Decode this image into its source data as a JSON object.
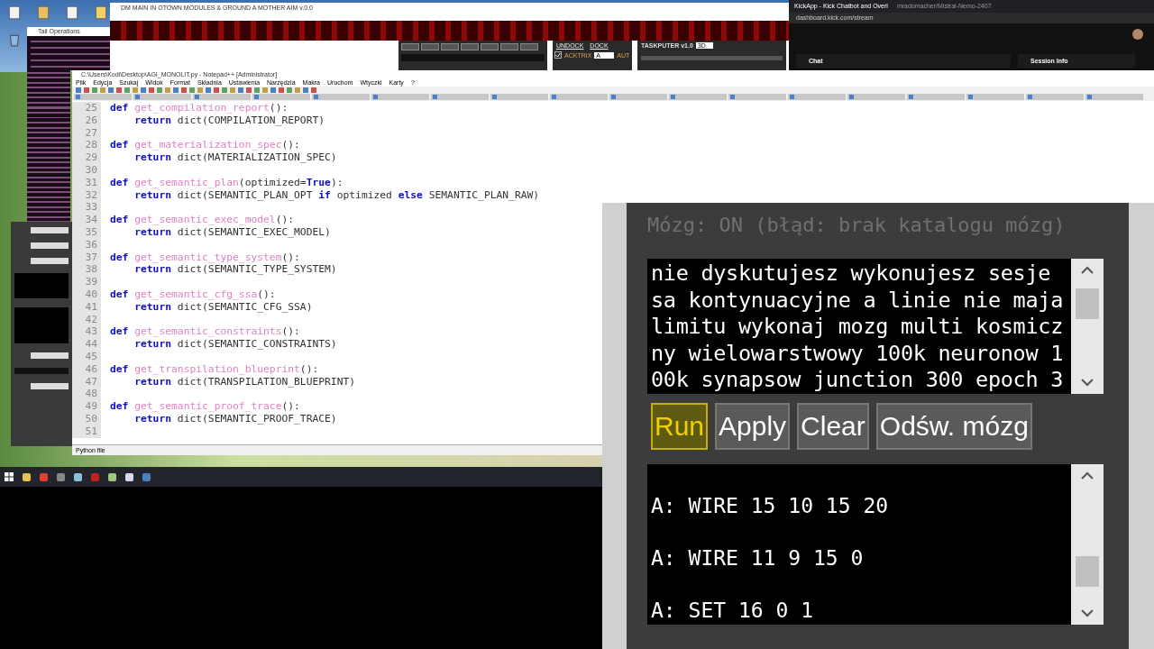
{
  "log_window": {
    "title": "Tail Operations"
  },
  "app_window": {
    "title": "DM MAIN IN OTOWN MODULES & GROUND A MOTHER AIM v.0.0",
    "dock2": {
      "buttons": [
        "UNDOCK",
        "DOCK"
      ],
      "checkbox": {
        "label": "ACKTRIX",
        "checked": true
      },
      "select": "A",
      "trailing": "AUT"
    },
    "taskputer": {
      "title": "TASKPUTER v1.0",
      "mode": "3D"
    }
  },
  "browser": {
    "tabs": [
      {
        "title": "KickApp - Kick Chatbot and Overl",
        "selected": true
      },
      {
        "title": "mradomacher/Mistral-Nemo-2407",
        "selected": false
      }
    ],
    "url": "dashboard.kick.com/stream",
    "panels": [
      "Chat",
      "Session Info"
    ]
  },
  "editor": {
    "title": "C:\\Users\\Kodi\\Desktop\\AGI_MONOLIT.py - Notepad++ [Administrator]",
    "menu": [
      "Plik",
      "Edycja",
      "Szukaj",
      "Widok",
      "Format",
      "Składnia",
      "Ustawienia",
      "Narzędzia",
      "Makra",
      "Uruchom",
      "Wtyczki",
      "Karty",
      "?"
    ],
    "lines": [
      {
        "number": "25",
        "tokens": [
          {
            "text": "def ",
            "kind": "kw"
          },
          {
            "text": "get_compilation_report",
            "kind": "fn"
          },
          {
            "text": "():",
            "kind": "plain"
          }
        ]
      },
      {
        "number": "26",
        "tokens": [
          {
            "text": "    return ",
            "kind": "kw"
          },
          {
            "text": "dict(COMPILATION_REPORT)",
            "kind": "plain"
          }
        ]
      },
      {
        "number": "27"
      },
      {
        "number": "28",
        "tokens": [
          {
            "text": "def ",
            "kind": "kw"
          },
          {
            "text": "get_materialization_spec",
            "kind": "fn"
          },
          {
            "text": "():",
            "kind": "plain"
          }
        ]
      },
      {
        "number": "29",
        "tokens": [
          {
            "text": "    return ",
            "kind": "kw"
          },
          {
            "text": "dict(MATERIALIZATION_SPEC)",
            "kind": "plain"
          }
        ]
      },
      {
        "number": "30"
      },
      {
        "number": "31",
        "tokens": [
          {
            "text": "def ",
            "kind": "kw"
          },
          {
            "text": "get_semantic_plan",
            "kind": "fn"
          },
          {
            "text": "(optimized=",
            "kind": "plain"
          },
          {
            "text": "True",
            "kind": "kw"
          },
          {
            "text": "):",
            "kind": "plain"
          }
        ]
      },
      {
        "number": "32",
        "tokens": [
          {
            "text": "    return ",
            "kind": "kw"
          },
          {
            "text": "dict(SEMANTIC_PLAN_OPT ",
            "kind": "plain"
          },
          {
            "text": "if ",
            "kind": "kw"
          },
          {
            "text": "optimized ",
            "kind": "plain"
          },
          {
            "text": "else ",
            "kind": "kw"
          },
          {
            "text": "SEMANTIC_PLAN_RAW)",
            "kind": "plain"
          }
        ]
      },
      {
        "number": "33"
      },
      {
        "number": "34",
        "tokens": [
          {
            "text": "def ",
            "kind": "kw"
          },
          {
            "text": "get_semantic_exec_model",
            "kind": "fn"
          },
          {
            "text": "():",
            "kind": "plain"
          }
        ]
      },
      {
        "number": "35",
        "tokens": [
          {
            "text": "    return ",
            "kind": "kw"
          },
          {
            "text": "dict(SEMANTIC_EXEC_MODEL)",
            "kind": "plain"
          }
        ]
      },
      {
        "number": "36"
      },
      {
        "number": "37",
        "tokens": [
          {
            "text": "def ",
            "kind": "kw"
          },
          {
            "text": "get_semantic_type_system",
            "kind": "fn"
          },
          {
            "text": "():",
            "kind": "plain"
          }
        ]
      },
      {
        "number": "38",
        "tokens": [
          {
            "text": "    return ",
            "kind": "kw"
          },
          {
            "text": "dict(SEMANTIC_TYPE_SYSTEM)",
            "kind": "plain"
          }
        ]
      },
      {
        "number": "39"
      },
      {
        "number": "40",
        "tokens": [
          {
            "text": "def ",
            "kind": "kw"
          },
          {
            "text": "get_semantic_cfg_ssa",
            "kind": "fn"
          },
          {
            "text": "():",
            "kind": "plain"
          }
        ]
      },
      {
        "number": "41",
        "tokens": [
          {
            "text": "    return ",
            "kind": "kw"
          },
          {
            "text": "dict(SEMANTIC_CFG_SSA)",
            "kind": "plain"
          }
        ]
      },
      {
        "number": "42"
      },
      {
        "number": "43",
        "tokens": [
          {
            "text": "def ",
            "kind": "kw"
          },
          {
            "text": "get_semantic_constraints",
            "kind": "fn"
          },
          {
            "text": "():",
            "kind": "plain"
          }
        ]
      },
      {
        "number": "44",
        "tokens": [
          {
            "text": "    return ",
            "kind": "kw"
          },
          {
            "text": "dict(SEMANTIC_CONSTRAINTS)",
            "kind": "plain"
          }
        ]
      },
      {
        "number": "45"
      },
      {
        "number": "46",
        "tokens": [
          {
            "text": "def ",
            "kind": "kw"
          },
          {
            "text": "get_transpilation_blueprint",
            "kind": "fn"
          },
          {
            "text": "():",
            "kind": "plain"
          }
        ]
      },
      {
        "number": "47",
        "tokens": [
          {
            "text": "    return ",
            "kind": "kw"
          },
          {
            "text": "dict(TRANSPILATION_BLUEPRINT)",
            "kind": "plain"
          }
        ]
      },
      {
        "number": "48"
      },
      {
        "number": "49",
        "tokens": [
          {
            "text": "def ",
            "kind": "kw"
          },
          {
            "text": "get_semantic_proof_trace",
            "kind": "fn"
          },
          {
            "text": "():",
            "kind": "plain"
          }
        ]
      },
      {
        "number": "50",
        "tokens": [
          {
            "text": "    return ",
            "kind": "kw"
          },
          {
            "text": "dict(SEMANTIC_PROOF_TRACE)",
            "kind": "plain"
          }
        ]
      },
      {
        "number": "51"
      }
    ],
    "status": "Python file"
  },
  "magnifier": {
    "status": "Mózg: ON (błąd: brak katalogu mózg)",
    "prompt_lines": [
      "nie dyskutujesz wykonujesz sesje",
      "sa kontynuacyjne a linie nie maja",
      "limitu wykonaj mozg multi kosmicz",
      "ny wielowarstwowy 100k neuronow 1",
      "00k synapsow junction 300 epoch 3"
    ],
    "buttons": [
      {
        "label": "Run",
        "selected": true
      },
      {
        "label": "Apply",
        "selected": false
      },
      {
        "label": "Clear",
        "selected": false
      },
      {
        "label": "Odśw. mózg",
        "selected": false
      }
    ],
    "output_lines": [
      "A: WIRE 15 10 15 20",
      "A: WIRE 11 9 15 0",
      "A: SET 16 0 1"
    ]
  }
}
